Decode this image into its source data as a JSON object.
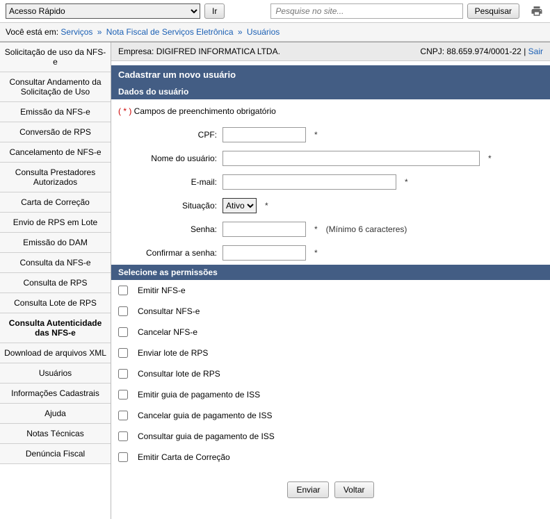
{
  "topbar": {
    "quick_access_label": "Acesso Rápido",
    "go_label": "Ir",
    "search_placeholder": "Pesquise no site...",
    "search_button": "Pesquisar"
  },
  "breadcrumb": {
    "prefix": "Você está em:",
    "items": [
      "Serviços",
      "Nota Fiscal de Serviços Eletrônica",
      "Usuários"
    ]
  },
  "sidebar": {
    "items": [
      {
        "label": "Solicitação de uso da NFS-e"
      },
      {
        "label": "Consultar Andamento da Solicitação de Uso"
      },
      {
        "label": "Emissão da NFS-e"
      },
      {
        "label": "Conversão de RPS"
      },
      {
        "label": "Cancelamento de NFS-e"
      },
      {
        "label": "Consulta Prestadores Autorizados"
      },
      {
        "label": "Carta de Correção"
      },
      {
        "label": "Envio de RPS em Lote"
      },
      {
        "label": "Emissão do DAM"
      },
      {
        "label": "Consulta da NFS-e"
      },
      {
        "label": "Consulta de RPS"
      },
      {
        "label": "Consulta Lote de RPS"
      },
      {
        "label": "Consulta Autenticidade das NFS-e",
        "bold": true
      },
      {
        "label": "Download de arquivos XML"
      },
      {
        "label": "Usuários"
      },
      {
        "label": "Informações Cadastrais"
      },
      {
        "label": "Ajuda"
      },
      {
        "label": "Notas Técnicas"
      },
      {
        "label": "Denúncia Fiscal"
      }
    ]
  },
  "header": {
    "company_prefix": "Empresa:",
    "company_name": "DIGIFRED INFORMATICA LTDA.",
    "cnpj_prefix": "CNPJ:",
    "cnpj": "88.659.974/0001-22",
    "logout": "Sair",
    "separator": " | "
  },
  "panel": {
    "title": "Cadastrar um novo usuário",
    "subtitle_data": "Dados do usuário",
    "required_note": "Campos de preenchimento obrigatório",
    "required_mark": "( * ) ",
    "subtitle_perm": "Selecione as permissões"
  },
  "form": {
    "cpf_label": "CPF:",
    "nome_label": "Nome do usuário:",
    "email_label": "E-mail:",
    "situacao_label": "Situação:",
    "situacao_value": "Ativo",
    "senha_label": "Senha:",
    "senha_hint": "(Mínimo 6 caracteres)",
    "confirmar_label": "Confirmar a senha:",
    "asterisk": "*"
  },
  "permissions": [
    {
      "label": "Emitir NFS-e"
    },
    {
      "label": "Consultar NFS-e"
    },
    {
      "label": "Cancelar NFS-e"
    },
    {
      "label": "Enviar lote de RPS"
    },
    {
      "label": "Consultar lote de RPS"
    },
    {
      "label": "Emitir guia de pagamento de ISS"
    },
    {
      "label": "Cancelar guia de pagamento de ISS"
    },
    {
      "label": "Consultar guia de pagamento de ISS"
    },
    {
      "label": "Emitir Carta de Correção"
    }
  ],
  "buttons": {
    "submit": "Enviar",
    "back": "Voltar"
  },
  "chart_data": null
}
